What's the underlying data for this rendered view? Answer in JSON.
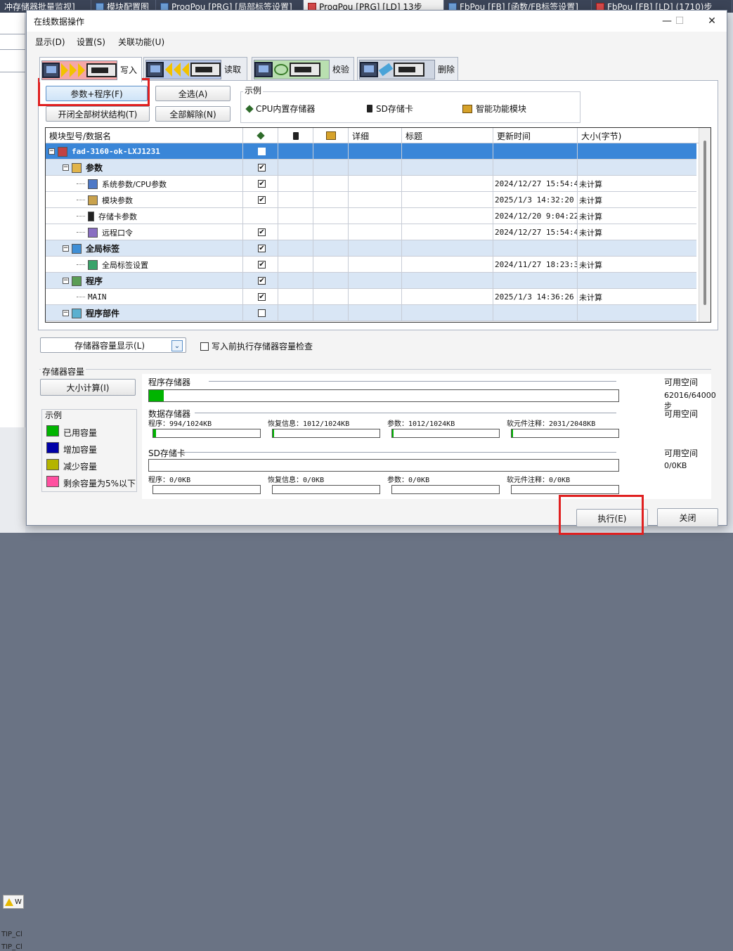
{
  "bg_app": {
    "tabs": [
      {
        "label": "冲存储器批量监视]",
        "active": false,
        "red": false
      },
      {
        "label": "模块配置图",
        "active": false,
        "red": false
      },
      {
        "label": "ProgPou [PRG] [局部标签设置]",
        "active": false,
        "red": false
      },
      {
        "label": "ProgPou [PRG] [LD] 13步",
        "active": true,
        "red": true
      },
      {
        "label": "FbPou [FB] [函数/FB标签设置]",
        "active": false,
        "red": false
      },
      {
        "label": "FbPou [FB] [LD] (1710)步",
        "active": false,
        "red": true
      }
    ],
    "warn_text": "W",
    "tip_lines": [
      "TIP_Cl",
      "TIP_Cl"
    ]
  },
  "dialog": {
    "title": "在线数据操作",
    "controls": {
      "minimize": "—",
      "maximize": "☐",
      "close": "✕"
    },
    "menu": [
      "显示(D)",
      "设置(S)",
      "关联功能(U)"
    ],
    "op_tabs": [
      {
        "label": "写入",
        "active": true
      },
      {
        "label": "读取",
        "active": false
      },
      {
        "label": "校验",
        "active": false
      },
      {
        "label": "删除",
        "active": false
      }
    ],
    "buttons": {
      "param_prog": "参数+程序(F)",
      "select_all": "全选(A)",
      "expand_tree": "开闭全部树状结构(T)",
      "deselect_all": "全部解除(N)"
    },
    "legend": {
      "title": "示例",
      "items": [
        "CPU内置存储器",
        "SD存储卡",
        "智能功能模块"
      ]
    },
    "tree": {
      "headers": [
        "模块型号/数据名",
        "",
        "",
        "",
        "详细",
        "标题",
        "更新时间",
        "大小(字节)"
      ],
      "rows": [
        {
          "name": "fad-3160-ok-LXJ1231",
          "level": 0,
          "type": "sel",
          "exp": "−",
          "icon": "ic-proj",
          "checked": false,
          "cb": true,
          "time": "",
          "size": ""
        },
        {
          "name": "参数",
          "level": 1,
          "type": "group",
          "exp": "−",
          "icon": "ic-param",
          "checked": true,
          "cb": true,
          "time": "",
          "size": ""
        },
        {
          "name": "系统参数/CPU参数",
          "level": 2,
          "type": "item",
          "exp": "",
          "icon": "ic-sys",
          "checked": true,
          "cb": true,
          "time": "2024/12/27 15:54:46",
          "size": "未计算"
        },
        {
          "name": "模块参数",
          "level": 2,
          "type": "item",
          "exp": "",
          "icon": "ic-mod",
          "checked": true,
          "cb": true,
          "time": "2025/1/3 14:32:20",
          "size": "未计算"
        },
        {
          "name": "存储卡参数",
          "level": 2,
          "type": "item",
          "exp": "",
          "icon": "ic-card",
          "checked": false,
          "cb": false,
          "time": "2024/12/20 9:04:22",
          "size": "未计算"
        },
        {
          "name": "远程口令",
          "level": 2,
          "type": "item",
          "exp": "",
          "icon": "ic-remote",
          "checked": true,
          "cb": true,
          "time": "2024/12/27 15:54:45",
          "size": "未计算"
        },
        {
          "name": "全局标签",
          "level": 1,
          "type": "group",
          "exp": "−",
          "icon": "ic-label",
          "checked": true,
          "cb": true,
          "time": "",
          "size": ""
        },
        {
          "name": "全局标签设置",
          "level": 2,
          "type": "item",
          "exp": "",
          "icon": "ic-labelset",
          "checked": true,
          "cb": true,
          "time": "2024/11/27 18:23:35",
          "size": "未计算"
        },
        {
          "name": "程序",
          "level": 1,
          "type": "group",
          "exp": "−",
          "icon": "ic-prog",
          "checked": true,
          "cb": true,
          "time": "",
          "size": ""
        },
        {
          "name": "MAIN",
          "level": 2,
          "type": "item",
          "exp": "",
          "icon": "ic-main",
          "checked": true,
          "cb": true,
          "time": "2025/1/3 14:36:26",
          "size": "未计算"
        },
        {
          "name": "程序部件",
          "level": 1,
          "type": "group",
          "exp": "−",
          "icon": "ic-part",
          "checked": false,
          "cb": true,
          "time": "",
          "size": ""
        }
      ]
    },
    "lower": {
      "capacity_display": "存储器容量显示(L)",
      "precheck_label": "写入前执行存储器容量检查",
      "capacity_title": "存储器容量",
      "calc_button": "大小计算(I)",
      "legend2": {
        "title": "示例",
        "items": [
          {
            "label": "已用容量",
            "color": "#00b400"
          },
          {
            "label": "增加容量",
            "color": "#0000a8"
          },
          {
            "label": "减少容量",
            "color": "#b4b400"
          },
          {
            "label": "剩余容量为5%以下",
            "color": "#ff50a0"
          }
        ]
      },
      "program_memory": {
        "title": "程序存储器",
        "avail_label": "可用空间",
        "avail_value": "62016/64000步",
        "used_fraction": 0.031
      },
      "data_memory": {
        "title": "数据存储器",
        "avail_label": "可用空间",
        "parts": [
          {
            "label": "程序：994/1024KB",
            "fraction": 0.029
          },
          {
            "label": "恢复信息：1012/1024KB",
            "fraction": 0.012
          },
          {
            "label": "参数：1012/1024KB",
            "fraction": 0.012
          },
          {
            "label": "软元件注释：2031/2048KB",
            "fraction": 0.008
          }
        ]
      },
      "sd_card": {
        "title": "SD存储卡",
        "avail_label": "可用空间",
        "avail_value": "0/0KB",
        "parts": [
          {
            "label": "程序：0/0KB"
          },
          {
            "label": "恢复信息：0/0KB"
          },
          {
            "label": "参数：0/0KB"
          },
          {
            "label": "软元件注释：0/0KB"
          }
        ]
      },
      "execute": "执行(E)",
      "close": "关闭"
    }
  }
}
